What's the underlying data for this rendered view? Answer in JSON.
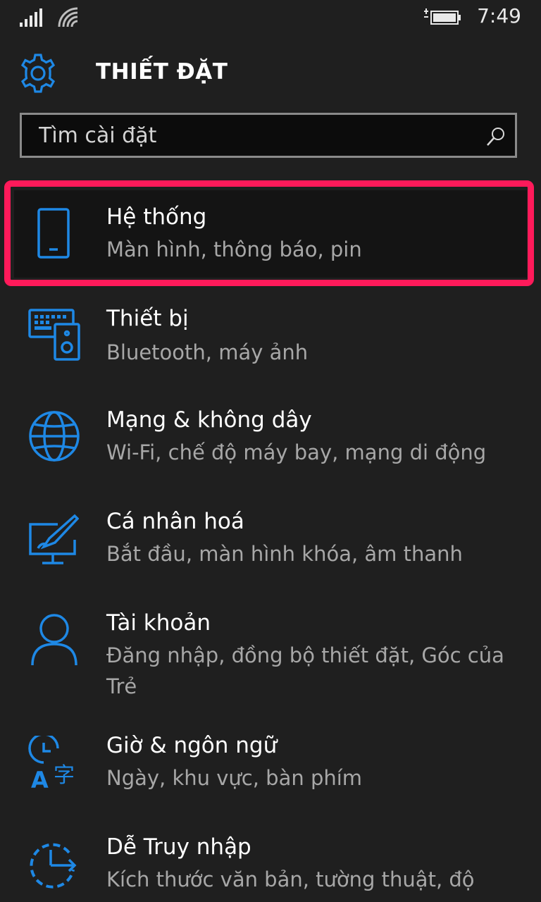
{
  "status_bar": {
    "time": "7:49",
    "icons": [
      "signal-icon",
      "wifi-icon",
      "battery-charging-icon"
    ]
  },
  "header": {
    "title": "THIẾT ĐẶT",
    "icon": "gear-icon"
  },
  "search": {
    "placeholder": "Tìm cài đặt",
    "value": ""
  },
  "colors": {
    "accent": "#1e88e5",
    "highlight_border": "#ff1a5a",
    "background": "#1f1f1f",
    "secondary_text": "#a7a7a7"
  },
  "items": [
    {
      "label": "Hệ thống",
      "desc": "Màn hình, thông báo, pin",
      "icon": "phone-icon",
      "highlighted": true
    },
    {
      "label": "Thiết bị",
      "desc": "Bluetooth, máy ảnh",
      "icon": "devices-icon"
    },
    {
      "label": "Mạng & không dây",
      "desc": "Wi-Fi, chế độ máy bay, mạng di động",
      "icon": "globe-icon"
    },
    {
      "label": "Cá nhân hoá",
      "desc": "Bắt đầu, màn hình khóa, âm thanh",
      "icon": "personalization-icon"
    },
    {
      "label": "Tài khoản",
      "desc": "Đăng nhập, đồng bộ thiết đặt, Góc của Trẻ",
      "icon": "person-icon"
    },
    {
      "label": "Giờ & ngôn ngữ",
      "desc": "Ngày, khu vực, bàn phím",
      "icon": "time-language-icon"
    },
    {
      "label": "Dễ Truy nhập",
      "desc": "Kích thước văn bản, tường thuật, độ",
      "icon": "ease-of-access-icon"
    }
  ]
}
